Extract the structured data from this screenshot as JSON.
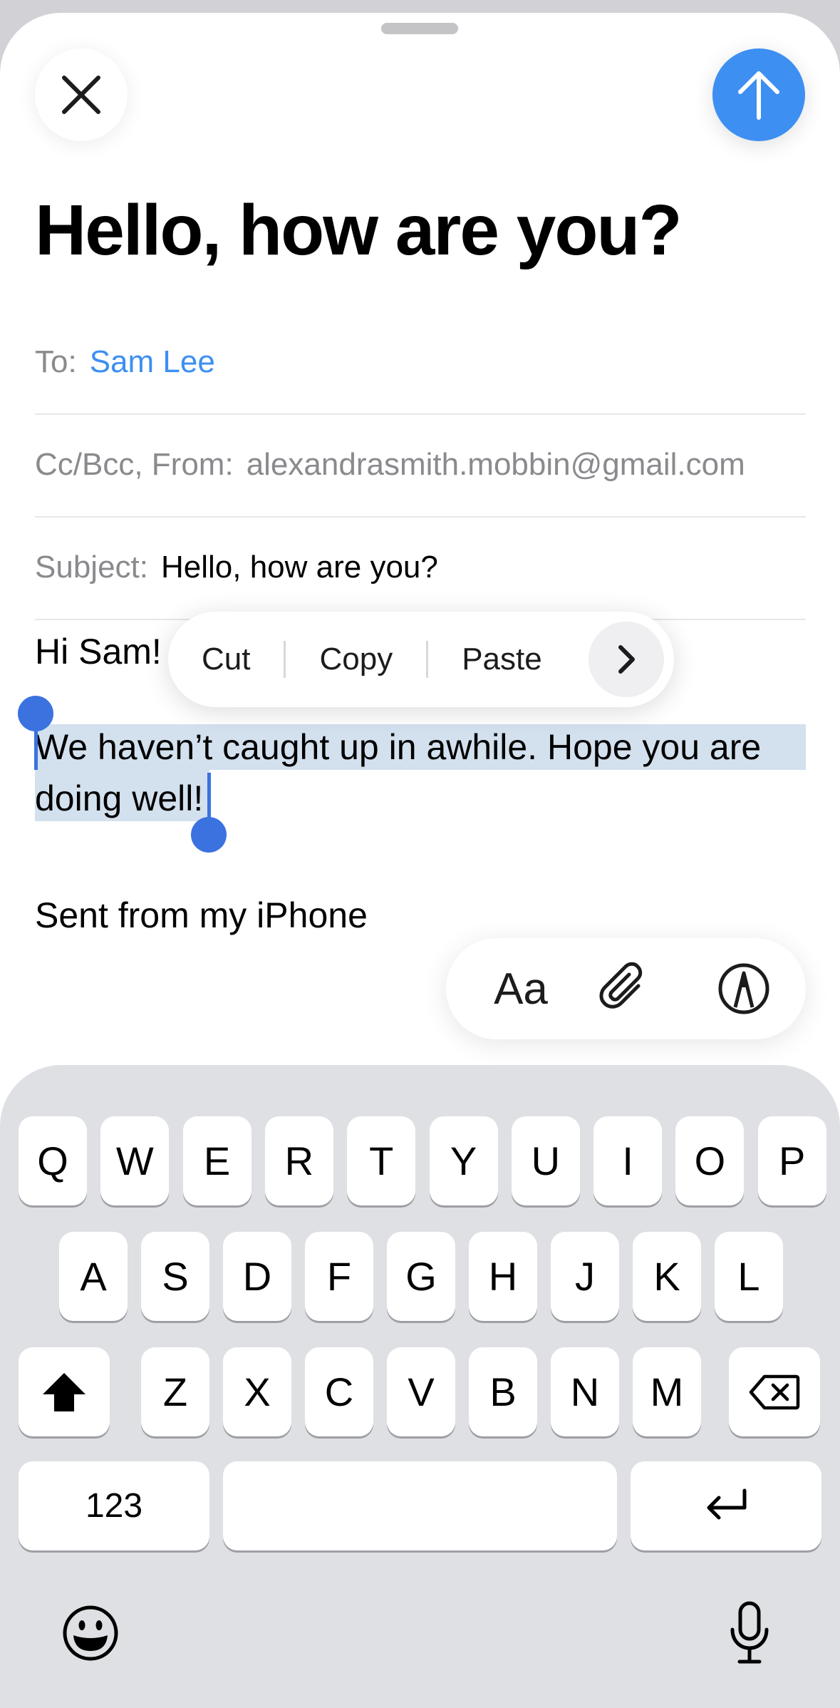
{
  "header": {
    "close_icon": "close-icon",
    "send_icon": "arrow-up-icon",
    "title": "Hello, how are you?"
  },
  "fields": {
    "to_label": "To:",
    "to_value": "Sam Lee",
    "from_label": "Cc/Bcc, From:",
    "from_value": "alexandrasmith.mobbin@gmail.com",
    "subject_label": "Subject:",
    "subject_value": "Hello, how are you?"
  },
  "body": {
    "greeting": "Hi Sam!",
    "selected_line_1": "We haven’t caught up in awhile. Hope you are",
    "selected_line_2": "doing well!",
    "signature": "Sent from my iPhone"
  },
  "edit_menu": {
    "cut": "Cut",
    "copy": "Copy",
    "paste": "Paste",
    "more_icon": "chevron-right-icon"
  },
  "format_bar": {
    "text_format": "Aa",
    "attach_icon": "paperclip-icon",
    "markup_icon": "markup-pen-icon"
  },
  "keyboard": {
    "row1": [
      "Q",
      "W",
      "E",
      "R",
      "T",
      "Y",
      "U",
      "I",
      "O",
      "P"
    ],
    "row2": [
      "A",
      "S",
      "D",
      "F",
      "G",
      "H",
      "J",
      "K",
      "L"
    ],
    "row3": [
      "Z",
      "X",
      "C",
      "V",
      "B",
      "N",
      "M"
    ],
    "numbers_label": "123",
    "space_label": "",
    "shift_icon": "shift-icon",
    "delete_icon": "delete-icon",
    "return_icon": "return-icon",
    "emoji_icon": "emoji-icon",
    "mic_icon": "microphone-icon"
  },
  "colors": {
    "accent": "#3d8ff2",
    "selection": "#d3e0ee",
    "selection_handle": "#3b72e0",
    "keyboard_bg": "#dfe0e4"
  }
}
